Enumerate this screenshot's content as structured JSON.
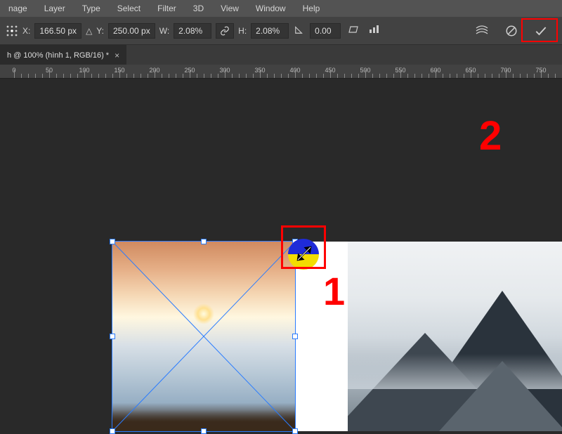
{
  "menu": [
    "nage",
    "Layer",
    "Type",
    "Select",
    "Filter",
    "3D",
    "View",
    "Window",
    "Help"
  ],
  "options": {
    "x_label": "X:",
    "x_value": "166.50 px",
    "y_label": "Y:",
    "y_value": "250.00 px",
    "w_label": "W:",
    "w_value": "2.08%",
    "link": "⛓",
    "h_label": "H:",
    "h_value": "2.08%",
    "angle_value": "0.00"
  },
  "tab": {
    "title": "h @ 100% (hình 1, RGB/16) *"
  },
  "ruler_ticks": [
    0,
    50,
    100,
    150,
    200,
    250,
    300,
    350,
    400,
    450,
    500,
    550,
    600,
    650,
    700,
    750
  ],
  "annotations": {
    "one": "1",
    "two": "2"
  }
}
